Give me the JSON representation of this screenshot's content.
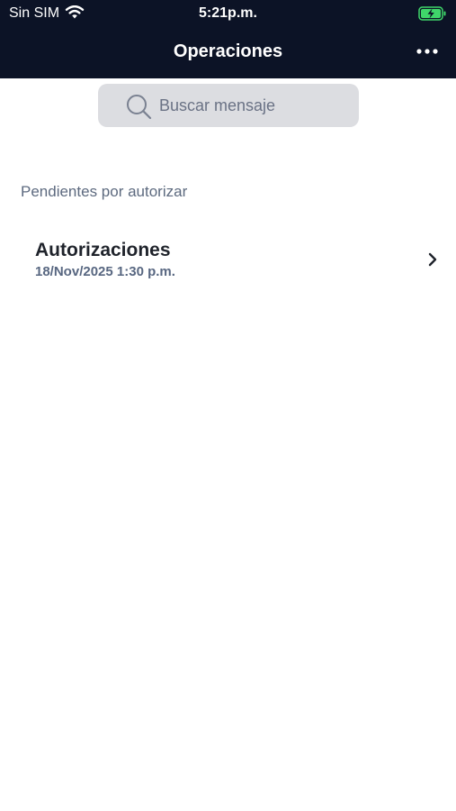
{
  "status_bar": {
    "carrier": "Sin SIM",
    "time": "5:21p.m.",
    "wifi_icon": "wifi-icon",
    "battery_icon": "battery-charging-icon",
    "battery_color": "#3fd66a"
  },
  "nav": {
    "title": "Operaciones",
    "more_icon": "more-horizontal-icon",
    "background_color": "#0c1326"
  },
  "search": {
    "placeholder": "Buscar mensaje",
    "value": "",
    "icon": "search-icon"
  },
  "section": {
    "title": "Pendientes por autorizar"
  },
  "items": [
    {
      "title": "Autorizaciones",
      "subtitle": "18/Nov/2025 1:30 p.m.",
      "icon": "chevron-right-icon"
    }
  ]
}
